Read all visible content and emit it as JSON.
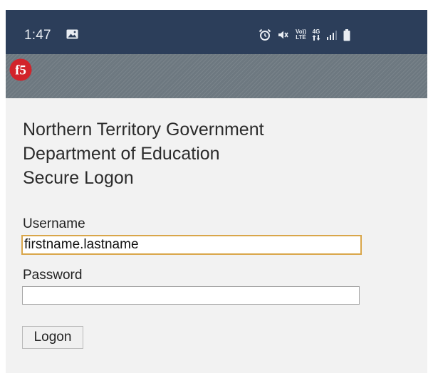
{
  "status_bar": {
    "time": "1:47",
    "icons": [
      "gallery-icon",
      "alarm-icon",
      "mute-icon",
      "volte-icon",
      "4g-icon",
      "signal-icon",
      "battery-icon"
    ],
    "volte_top": "Vo))",
    "volte_bottom": "LTE",
    "network": "4G"
  },
  "header": {
    "logo": "f5"
  },
  "title_lines": [
    "Northern Territory Government",
    "Department of Education",
    "Secure Logon"
  ],
  "form": {
    "username_label": "Username",
    "username_value": "firstname.lastname",
    "password_label": "Password",
    "password_value": "",
    "logon_label": "Logon"
  },
  "colors": {
    "status_bar": "#2c3e5a",
    "header_band": "#6d7880",
    "logo_red": "#d2232a",
    "focus_border": "#d9a64a",
    "page_background": "#f2f2f2"
  }
}
